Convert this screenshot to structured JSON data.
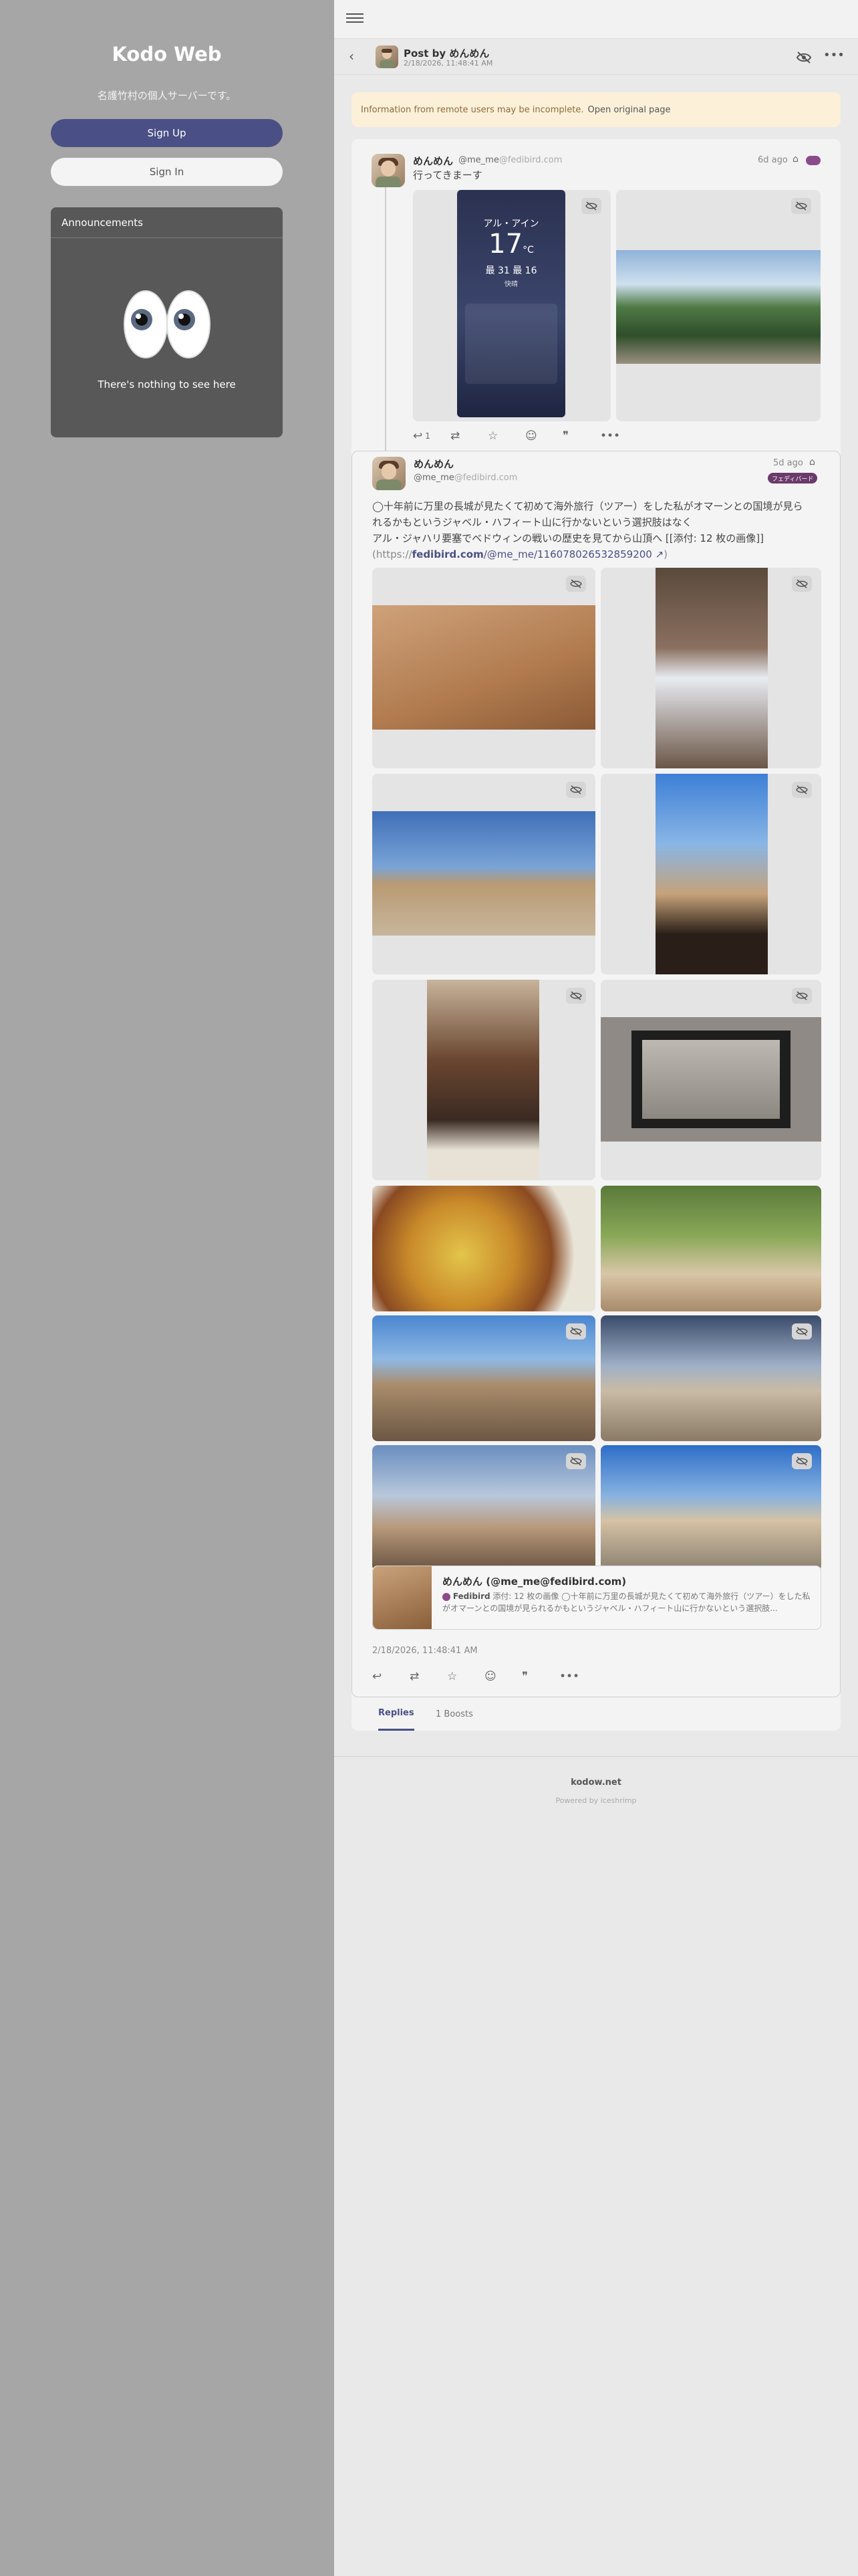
{
  "sidebar": {
    "brand": "Kodo Web",
    "tagline": "名護竹村の個人サーバーです。",
    "signup": "Sign Up",
    "signin": "Sign In",
    "announcements": {
      "title": "Announcements",
      "empty": "There's nothing to see here"
    }
  },
  "header": {
    "title": "Post by めんめん",
    "date": "2/18/2026, 11:48:41 AM"
  },
  "warning": {
    "text": "Information from remote users may be incomplete.",
    "link": "Open original page"
  },
  "reply_note": {
    "name": "めんめん",
    "handle": "@me_me",
    "host": "@fedibird.com",
    "time": "6d ago",
    "text": "行ってきまーす",
    "reply_count": "1"
  },
  "main_note": {
    "name": "めんめん",
    "handle": "@me_me",
    "host": "@fedibird.com",
    "time": "5d ago",
    "badge": "フェディバード",
    "text_line1": "◯十年前に万里の長城が見たくて初めて海外旅行（ツアー）をした私がオマーンとの国境が見ら",
    "text_line2": "れるかもというジャベル・ハフィート山に行かないという選択肢はなく",
    "text_line3": "アル・ジャハリ要塞でベドウィンの戦いの歴史を見てから山頂へ [[添付: 12 枚の画像]]",
    "link_prefix": "(https://",
    "link_host": "fedibird.com",
    "link_path": "/@me_me/116078026532859200",
    "link_suffix": ")",
    "timestamp": "2/18/2026, 11:48:41 AM"
  },
  "phone_screen": {
    "city": "アル・アイン",
    "temp": "17",
    "unit": "°C",
    "hilo": "最 31 最 16",
    "cond": "快晴"
  },
  "quote": {
    "title": "めんめん (@me_me@fedibird.com)",
    "source": "Fedibird",
    "body": "添付: 12 枚の画像 ◯十年前に万里の長城が見たくて初めて海外旅行（ツアー）をした私がオマーンとの国境が見られるかもというジャベル・ハフィート山に行かないという選択肢..."
  },
  "tabs": {
    "replies": "Replies",
    "boosts": "1 Boosts"
  },
  "footer": {
    "domain": "kodow.net",
    "powered": "Powered by iceshrimp"
  },
  "colors": {
    "sidebar_bg": "#a6a6a6",
    "accent": "#4a5085",
    "warning_bg": "#fdf0d9"
  }
}
